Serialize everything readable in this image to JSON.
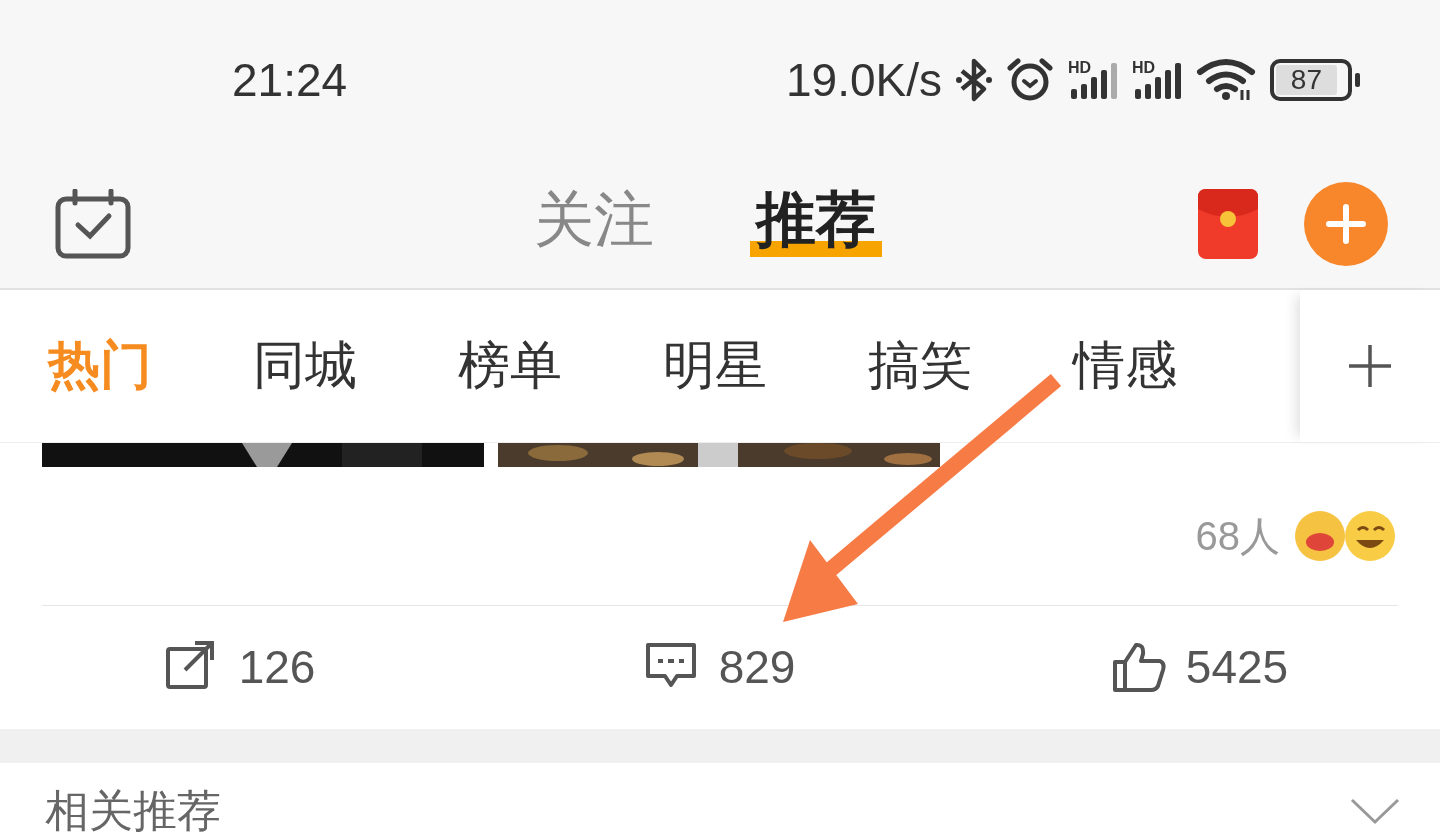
{
  "status_bar": {
    "time": "21:24",
    "net_speed": "19.0K/s",
    "battery": "87",
    "signal_labels": [
      "HD",
      "HD"
    ]
  },
  "header": {
    "tabs": [
      {
        "label": "关注",
        "selected": false
      },
      {
        "label": "推荐",
        "selected": true
      }
    ]
  },
  "channels": [
    {
      "label": "热门",
      "selected": true
    },
    {
      "label": "同城",
      "selected": false
    },
    {
      "label": "榜单",
      "selected": false
    },
    {
      "label": "明星",
      "selected": false
    },
    {
      "label": "搞笑",
      "selected": false
    },
    {
      "label": "情感",
      "selected": false
    }
  ],
  "post": {
    "reactions": "68人",
    "actions": [
      {
        "kind": "share",
        "count": "126"
      },
      {
        "kind": "comment",
        "count": "829"
      },
      {
        "kind": "like",
        "count": "5425"
      }
    ]
  },
  "related": {
    "title": "相关推荐"
  }
}
